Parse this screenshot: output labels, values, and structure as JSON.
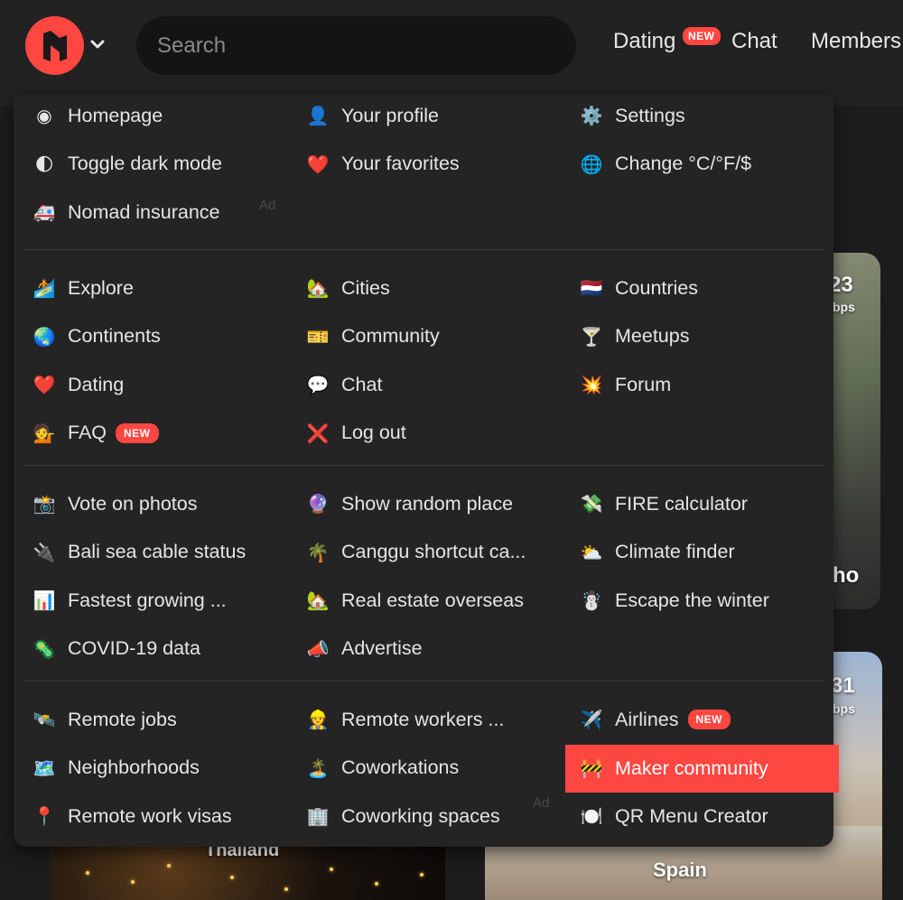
{
  "header": {
    "search_placeholder": "Search",
    "nav": [
      {
        "label": "Dating",
        "badge": "NEW"
      },
      {
        "label": "Chat"
      },
      {
        "label": "Members"
      }
    ],
    "brand_color": "#ff4742"
  },
  "background": {
    "card_a_number": "23",
    "card_a_unit": "bps",
    "card_a_city": "ho",
    "card_b_number": "31",
    "card_b_unit": "bps",
    "card_b_city": "Spain",
    "card_c_city": "Thailand"
  },
  "menu": {
    "ad_label": "Ad",
    "sections": [
      {
        "rows": [
          [
            {
              "icon": "logo-icon",
              "emoji": "◉",
              "label": "Homepage"
            },
            {
              "icon": "profile-avatar-icon",
              "emoji": "👤",
              "label": "Your profile"
            },
            {
              "icon": "gear-icon",
              "emoji": "⚙️",
              "label": "Settings"
            }
          ],
          [
            {
              "icon": "moon-icon",
              "emoji": "🌓",
              "label": "Toggle dark mode"
            },
            {
              "icon": "heart-icon",
              "emoji": "❤️",
              "label": "Your favorites"
            },
            {
              "icon": "globe-icon",
              "emoji": "🌐",
              "label": "Change °C/°F/$"
            }
          ],
          [
            {
              "icon": "ambulance-icon",
              "emoji": "🚑",
              "label": "Nomad insurance"
            }
          ]
        ]
      },
      {
        "rows": [
          [
            {
              "icon": "explore-icon",
              "emoji": "🏄",
              "label": "Explore"
            },
            {
              "icon": "house-icon",
              "emoji": "🏡",
              "label": "Cities"
            },
            {
              "icon": "flag-icon",
              "emoji": "🇳🇱",
              "label": "Countries"
            }
          ],
          [
            {
              "icon": "earth-icon",
              "emoji": "🌏",
              "label": "Continents"
            },
            {
              "icon": "id-card-icon",
              "emoji": "🎫",
              "label": "Community"
            },
            {
              "icon": "cocktail-icon",
              "emoji": "🍸",
              "label": "Meetups"
            }
          ],
          [
            {
              "icon": "heart-icon",
              "emoji": "❤️",
              "label": "Dating"
            },
            {
              "icon": "speech-bubble-icon",
              "emoji": "💬",
              "label": "Chat"
            },
            {
              "icon": "comic-burst-icon",
              "emoji": "💥",
              "label": "Forum"
            }
          ],
          [
            {
              "icon": "person-tipping-hand-icon",
              "emoji": "💁",
              "label": "FAQ",
              "badge": "NEW"
            },
            {
              "icon": "cross-icon",
              "emoji": "❌",
              "label": "Log out"
            }
          ]
        ]
      },
      {
        "rows": [
          [
            {
              "icon": "camera-icon",
              "emoji": "📸",
              "label": "Vote on photos"
            },
            {
              "icon": "crystal-ball-icon",
              "emoji": "🔮",
              "label": "Show random place"
            },
            {
              "icon": "money-wings-icon",
              "emoji": "💸",
              "label": "FIRE calculator"
            }
          ],
          [
            {
              "icon": "plug-icon",
              "emoji": "🔌",
              "label": "Bali sea cable status"
            },
            {
              "icon": "palm-tree-icon",
              "emoji": "🌴",
              "label": "Canggu shortcut ca..."
            },
            {
              "icon": "sun-cloud-icon",
              "emoji": "⛅",
              "label": "Climate finder"
            }
          ],
          [
            {
              "icon": "bar-chart-icon",
              "emoji": "📊",
              "label": "Fastest growing ..."
            },
            {
              "icon": "house-icon",
              "emoji": "🏡",
              "label": "Real estate overseas"
            },
            {
              "icon": "snowman-icon",
              "emoji": "☃️",
              "label": "Escape the winter"
            }
          ],
          [
            {
              "icon": "virus-icon",
              "emoji": "🦠",
              "label": "COVID-19 data"
            },
            {
              "icon": "megaphone-icon",
              "emoji": "📣",
              "label": "Advertise"
            }
          ]
        ]
      },
      {
        "rows": [
          [
            {
              "icon": "satellite-icon",
              "emoji": "🛰️",
              "label": "Remote jobs"
            },
            {
              "icon": "worker-icon",
              "emoji": "👷",
              "label": "Remote workers ..."
            },
            {
              "icon": "airplane-icon",
              "emoji": "✈️",
              "label": "Airlines",
              "badge": "NEW"
            }
          ],
          [
            {
              "icon": "map-icon",
              "emoji": "🗺️",
              "label": "Neighborhoods"
            },
            {
              "icon": "island-icon",
              "emoji": "🏝️",
              "label": "Coworkations"
            },
            {
              "icon": "construction-icon",
              "emoji": "🚧",
              "label": "Maker community",
              "highlighted": true
            }
          ],
          [
            {
              "icon": "pin-icon",
              "emoji": "📍",
              "label": "Remote work visas"
            },
            {
              "icon": "office-icon",
              "emoji": "🏢",
              "label": "Coworking spaces"
            },
            {
              "icon": "plate-icon",
              "emoji": "🍽️",
              "label": "QR Menu Creator"
            }
          ]
        ]
      }
    ]
  }
}
